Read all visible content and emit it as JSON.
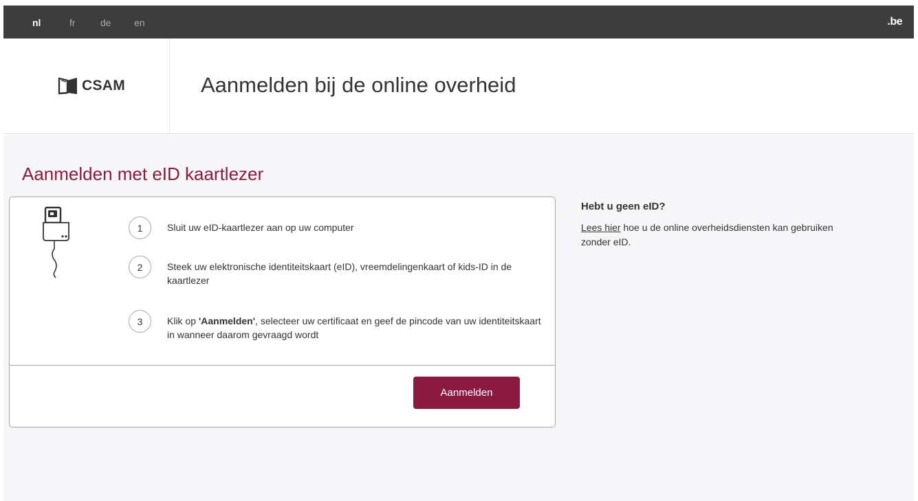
{
  "languages": [
    {
      "code": "nl",
      "active": true
    },
    {
      "code": "fr",
      "active": false
    },
    {
      "code": "de",
      "active": false
    },
    {
      "code": "en",
      "active": false
    }
  ],
  "top_bar": {
    "brand": ".be"
  },
  "header": {
    "logo_text": "CSAM",
    "title": "Aanmelden bij de online overheid"
  },
  "main": {
    "section_title": "Aanmelden met eID kaartlezer",
    "steps": [
      {
        "number": "1",
        "text": "Sluit uw eID-kaartlezer aan op uw computer"
      },
      {
        "number": "2",
        "text": "Steek uw elektronische identiteitskaart (eID), vreemdelingenkaart of kids-ID in de kaartlezer"
      },
      {
        "number": "3",
        "text_prefix": "Klik op ",
        "text_bold": "'Aanmelden'",
        "text_suffix": ", selecteer uw certificaat en geef de pincode van uw identiteitskaart in wanneer daarom gevraagd wordt"
      }
    ],
    "login_button": "Aanmelden"
  },
  "aside": {
    "title": "Hebt u geen eID?",
    "link_text": "Lees hier",
    "text_rest": " hoe u de online overheidsdiensten kan gebruiken zonder eID."
  },
  "colors": {
    "topbar": "#3d3d3e",
    "accent": "#8a1a3f",
    "background": "#f6f6f8"
  },
  "icons": {
    "logo": "csam-logo-icon",
    "reader": "card-reader-icon"
  }
}
